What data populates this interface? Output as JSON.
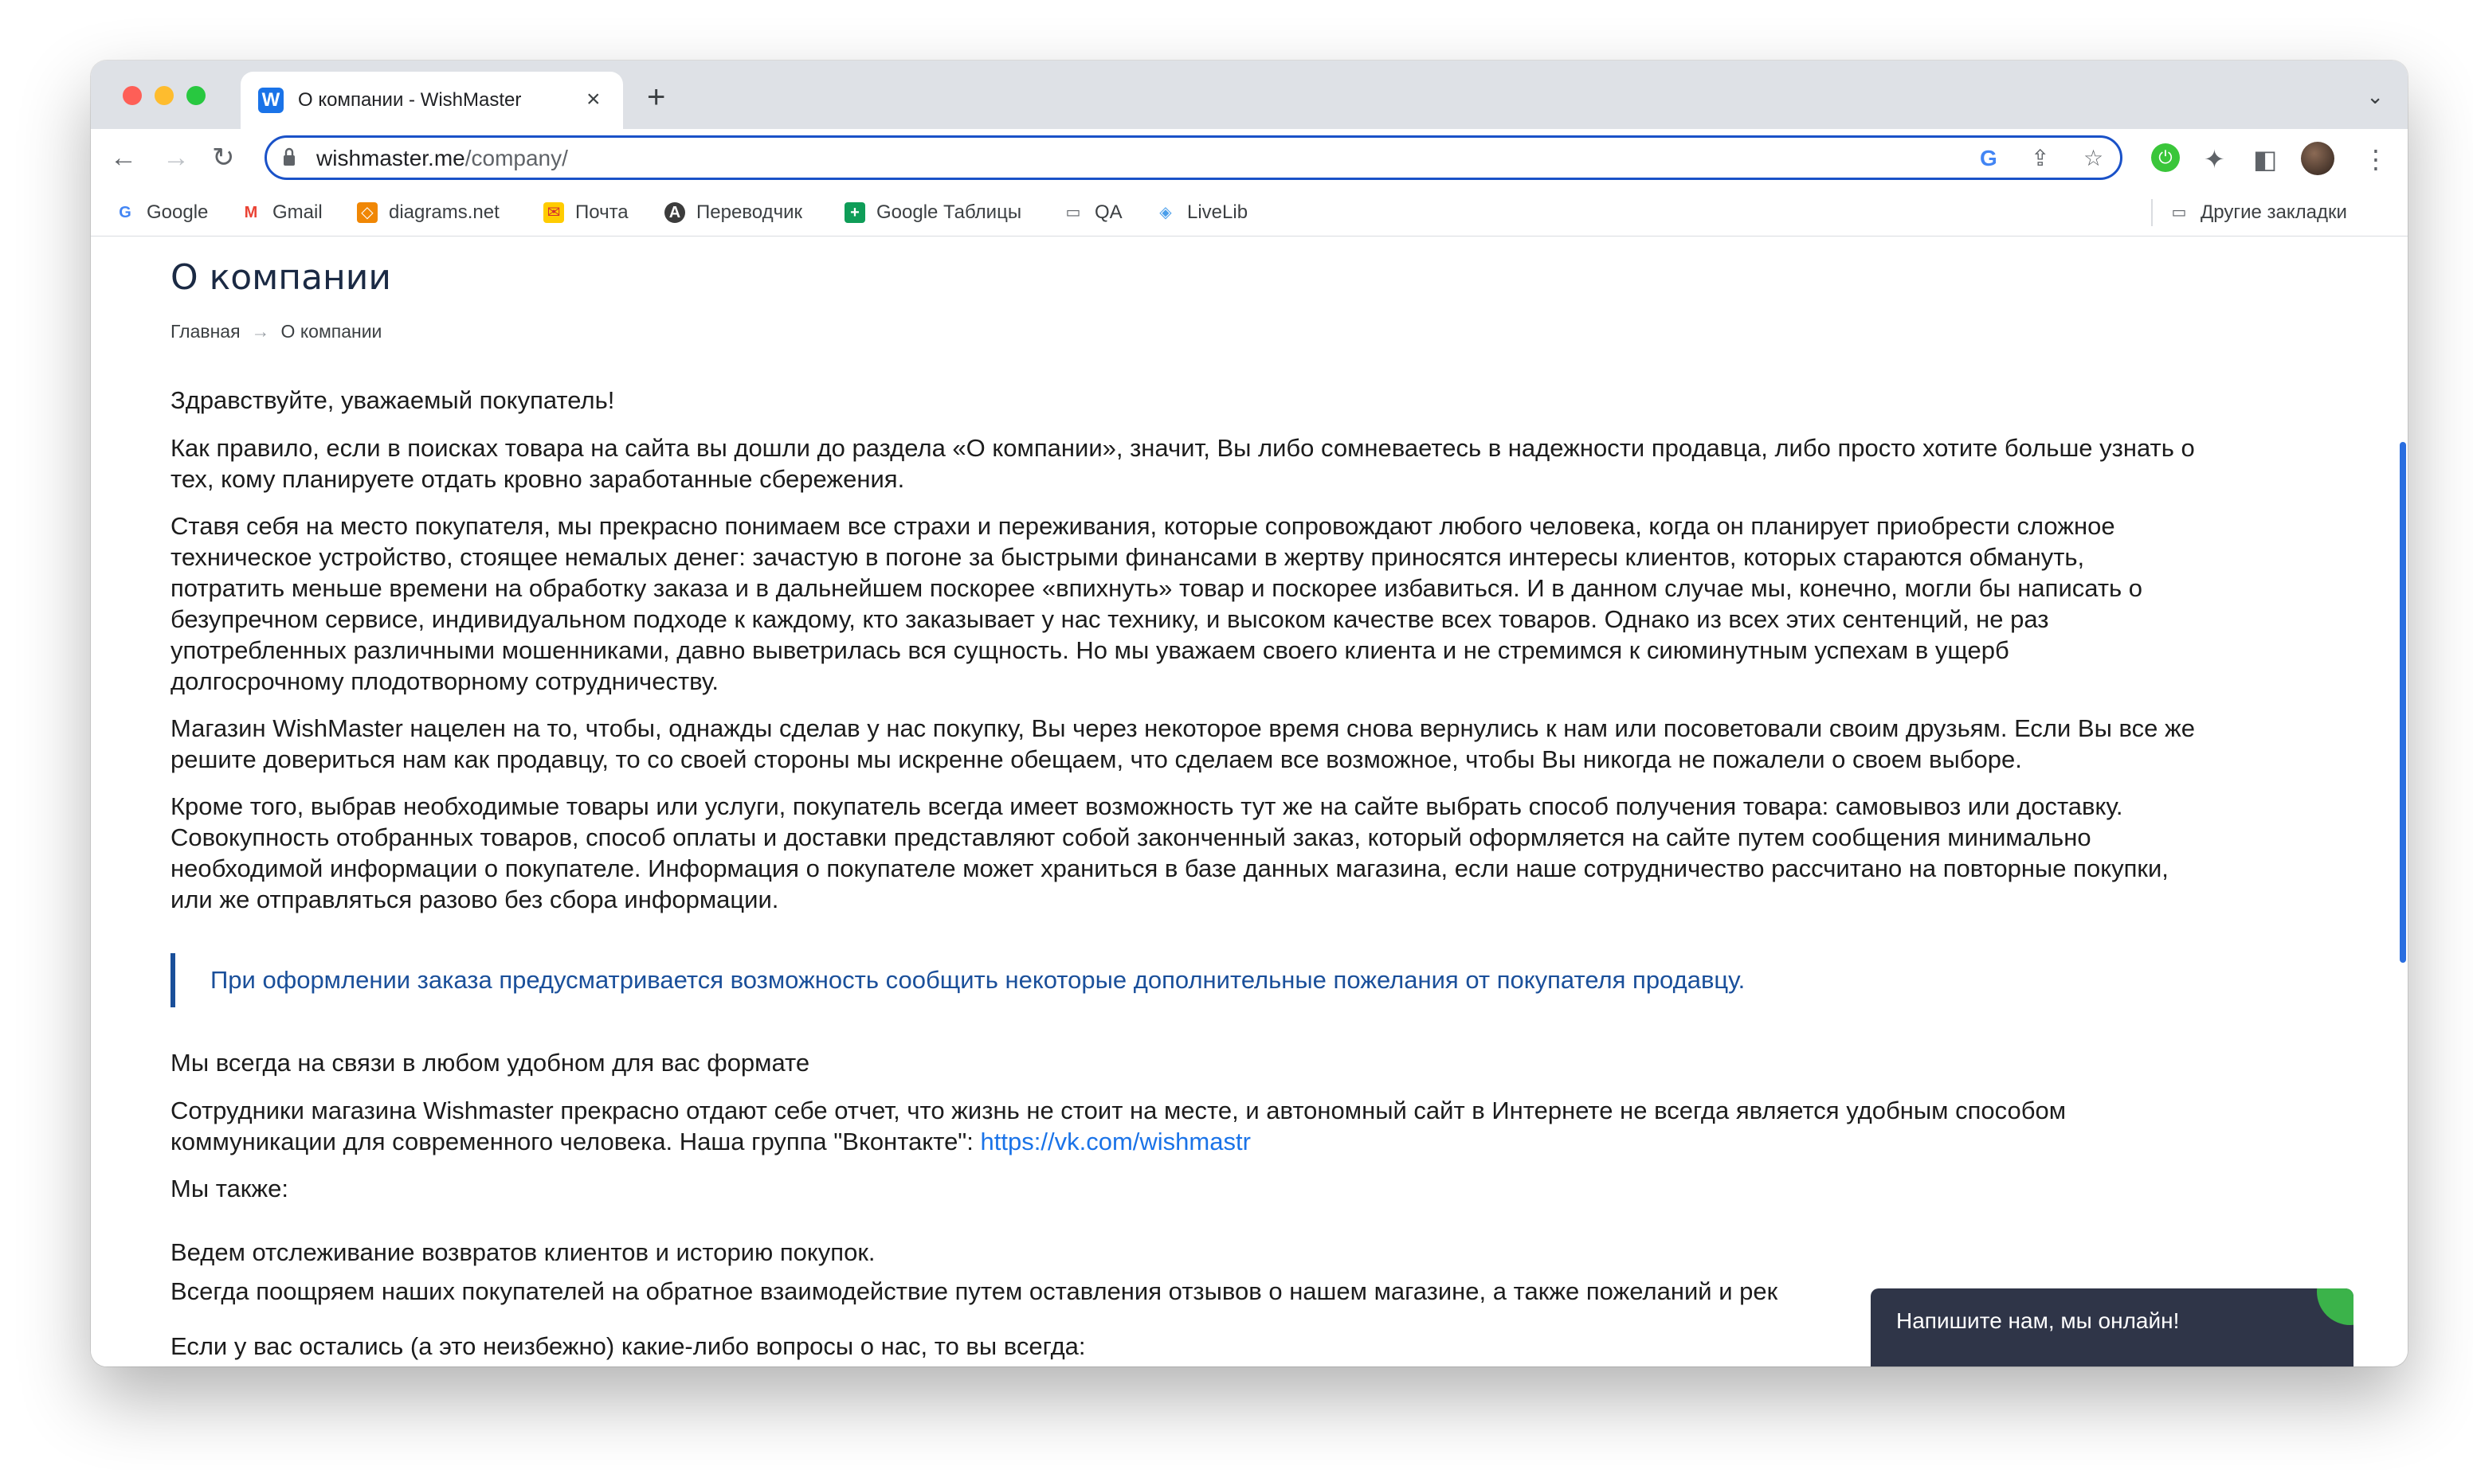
{
  "browser": {
    "tab": {
      "title": "О компании - WishMaster",
      "favicon": "W"
    },
    "new_tab_icon": "+",
    "close_icon": "×",
    "tab_list_icon": "⌄",
    "address": {
      "host": "wishmaster.me",
      "path": "/company/"
    },
    "bookmarks": [
      {
        "label": "Google"
      },
      {
        "label": "Gmail"
      },
      {
        "label": "diagrams.net"
      },
      {
        "label": "Почта"
      },
      {
        "label": "Переводчик"
      },
      {
        "label": "Google Таблицы"
      },
      {
        "label": "QA"
      },
      {
        "label": "LiveLib"
      }
    ],
    "other_bookmarks": "Другие закладки"
  },
  "page": {
    "title": "О компании",
    "breadcrumb": {
      "home": "Главная",
      "current": "О компании"
    },
    "paragraphs": {
      "greeting": "Здравствуйте, уважаемый покупатель!",
      "p1_l1": "Как правило, если в поисках товара на сайта вы дошли до раздела «О компании», значит, Вы либо сомневаетесь в надежности продавца, либо просто хотите больше узнать о",
      "p1_l2": "тех, кому планируете отдать кровно заработанные сбережения.",
      "p2_l1": "Ставя себя на место покупателя, мы прекрасно понимаем все страхи и переживания, которые сопровождают любого человека, когда он планирует приобрести сложное",
      "p2_l2": "техническое устройство, стоящее немалых денег: зачастую в погоне за быстрыми финансами в жертву приносятся интересы клиентов, которых стараются обмануть,",
      "p2_l3": "потратить меньше времени на обработку заказа и в дальнейшем поскорее «впихнуть» товар и поскорее избавиться. И в данном случае мы, конечно, могли бы написать о",
      "p2_l4": "безупречном сервисе, индивидуальном подходе к каждому, кто заказывает у нас технику, и высоком качестве всех товаров. Однако из всех этих сентенций, не раз",
      "p2_l5": "употребленных различными мошенниками, давно выветрилась вся сущность. Но мы уважаем своего клиента и не стремимся к сиюминутным успехам в ущерб",
      "p2_l6": "долгосрочному плодотворному сотрудничеству.",
      "p3_l1": "Магазин WishMaster нацелен на то, чтобы, однажды сделав у нас покупку, Вы через некоторое время снова вернулись к нам или посоветовали своим друзьям. Если Вы все же",
      "p3_l2": "решите довериться нам как продавцу, то со своей стороны мы искренне обещаем, что сделаем все возможное, чтобы Вы никогда не пожалели о своем выборе.",
      "p4_l1": "Кроме того, выбрав необходимые товары или услуги, покупатель всегда имеет возможность тут же на сайте выбрать способ получения товара: самовывоз или доставку.",
      "p4_l2": "Совокупность отобранных товаров, способ оплаты и доставки представляют собой законченный заказ, который оформляется на сайте путем сообщения минимально",
      "p4_l3": "необходимой информации о покупателе. Информация о покупателе может храниться в базе данных магазина, если наше сотрудничество рассчитано на повторные покупки,",
      "p4_l4": "или же отправляться разово без сбора информации."
    },
    "quote": "При оформлении заказа предусматривается возможность сообщить некоторые дополнительные пожелания от покупателя продавцу.",
    "contact_heading": "Мы всегда на связи в любом удобном для вас формате",
    "contact_l1": "Сотрудники магазина Wishmaster прекрасно отдают себе отчет, что жизнь не стоит на месте, и автономный сайт в Интернете не всегда является удобным способом",
    "contact_l2": "коммуникации для современного человека. Наша группа \"Вконтакте\": ",
    "vk_link": "https://vk.com/wishmastr",
    "also": "Мы также:",
    "also_l1": "Ведем отслеживание возвратов клиентов и историю покупок.",
    "also_l2": "Всегда поощряем наших покупателей на обратное взаимодействие путем оставления отзывов о нашем магазине, а также пожеланий и рек",
    "cut_line": "Если у вас остались (а это неизбежно) какие-либо вопросы о нас, то вы всегда:"
  },
  "chat": {
    "label": "Напишите нам, мы онлайн!"
  },
  "colors": {
    "accent": "#1a4f9a",
    "link": "#1a73e8",
    "chat_bg": "#2f3548",
    "chat_accent": "#3bb34a",
    "omnibox_border": "#1a52c8"
  }
}
